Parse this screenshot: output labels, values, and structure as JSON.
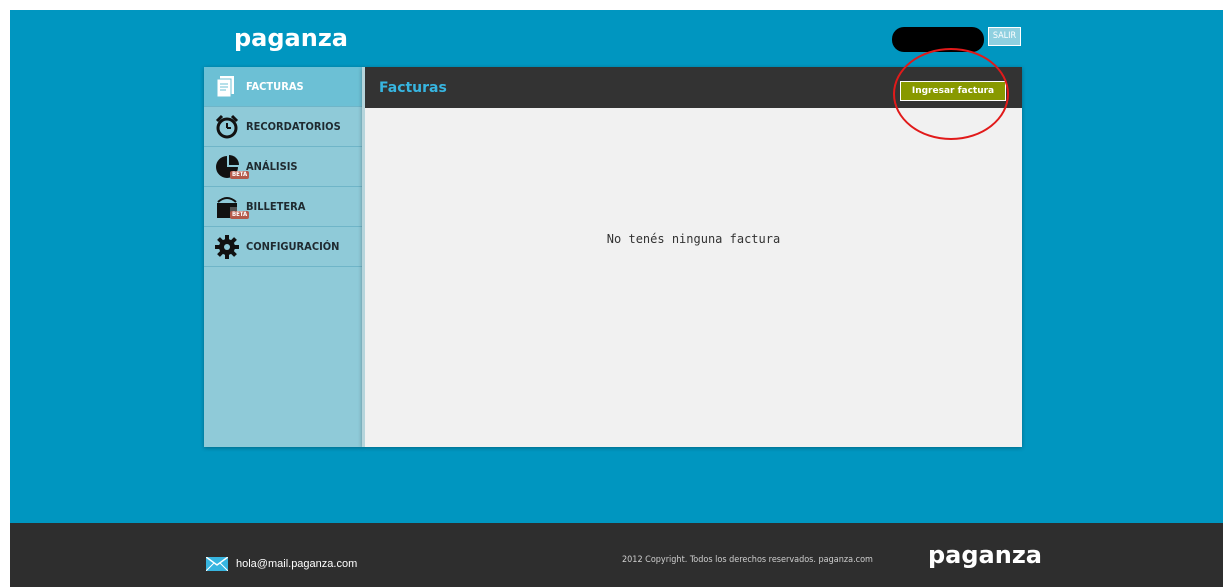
{
  "header": {
    "logo": "paganza",
    "logout_label": "SALIR"
  },
  "sidebar": {
    "items": [
      {
        "label": "FACTURAS",
        "icon": "invoice-icon",
        "active": true
      },
      {
        "label": "RECORDATORIOS",
        "icon": "alarm-clock-icon"
      },
      {
        "label": "ANÁLISIS",
        "icon": "pie-chart-icon",
        "badge": "BETA"
      },
      {
        "label": "BILLETERA",
        "icon": "wallet-icon",
        "badge": "BETA"
      },
      {
        "label": "CONFIGURACIÓN",
        "icon": "gear-icon"
      }
    ]
  },
  "main": {
    "title": "Facturas",
    "add_button": "Ingresar factura",
    "empty_message": "No tenés ninguna factura"
  },
  "footer": {
    "email": "hola@mail.paganza.com",
    "copyright": "2012 Copyright. Todos los derechos reservados. paganza.com",
    "logo": "paganza"
  },
  "colors": {
    "background": "#0096c0",
    "accent_button": "#889900",
    "header_bar": "#333333",
    "title": "#37b5e0",
    "annotation": "#e11a1a"
  }
}
